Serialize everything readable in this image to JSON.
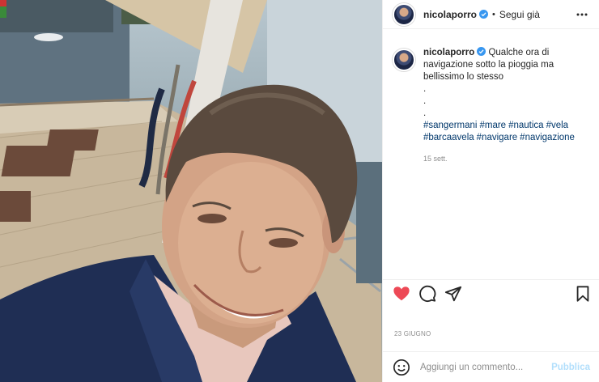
{
  "post": {
    "username": "nicolaporro",
    "follow_label": "Segui già",
    "separator": "•",
    "caption_text": "Qualche ora di navigazione sotto la pioggia ma bellissimo lo stesso",
    "caption_dots": [
      ".",
      ".",
      "."
    ],
    "hashtags": [
      "#sangermani",
      "#mare",
      "#nautica",
      "#vela",
      "#barcaavela",
      "#navigare",
      "#navigazione"
    ],
    "caption_time": "15 sett.",
    "date": "23 GIUGNO"
  },
  "comment_box": {
    "placeholder": "Aggiungi un commento...",
    "publish_label": "Pubblica"
  },
  "icons": {
    "verified": "verified-badge-icon",
    "more": "more-options-icon",
    "like": "heart-filled-icon",
    "comment": "comment-bubble-icon",
    "share": "paper-plane-icon",
    "save": "bookmark-icon",
    "emoji": "emoji-smile-icon"
  },
  "colors": {
    "like": "#ed4956",
    "link": "#00376b",
    "verified": "#3897f0",
    "publish": "#b2dffc"
  }
}
